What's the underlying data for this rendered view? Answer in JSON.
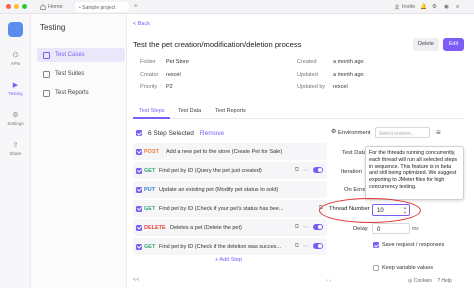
{
  "topbar": {
    "home_label": "Home",
    "tab_label": "Sample project",
    "invite_label": "Invite",
    "window_dots": [
      "#ff5f57",
      "#febc2e",
      "#28c840"
    ]
  },
  "rail": {
    "items": [
      {
        "label": "APIs",
        "icon": "api-icon"
      },
      {
        "label": "Testing",
        "icon": "testing-icon"
      },
      {
        "label": "Settings",
        "icon": "settings-icon"
      },
      {
        "label": "Share",
        "icon": "share-icon"
      }
    ]
  },
  "sidebar": {
    "project_title": "Testing",
    "items": [
      {
        "label": "Test Cases",
        "icon": "test-cases-icon"
      },
      {
        "label": "Test Suites",
        "icon": "test-suites-icon"
      },
      {
        "label": "Test Reports",
        "icon": "test-reports-icon"
      }
    ]
  },
  "header": {
    "back_label": "Back",
    "title": "Test the pet creation/modification/deletion process",
    "delete_label": "Delete",
    "edit_label": "Edit",
    "accent_color": "#7b5cf5"
  },
  "meta": {
    "folder_label": "Folder",
    "folder_value": "Pet Store",
    "creator_label": "Creator",
    "creator_value": "rexcel",
    "priority_label": "Priority",
    "priority_value": "P2",
    "created_label": "Created",
    "created_value": "a month ago",
    "updated_label": "Updated",
    "updated_value": "a month ago",
    "updated_by_label": "Updated by",
    "updated_by_value": "rexcel"
  },
  "tabs": [
    "Test Steps",
    "Test Data",
    "Test Reports"
  ],
  "steps": {
    "selected_label": "6 Step Selected",
    "remove_label": "Remove",
    "add_step_label": "+ Add Step",
    "items": [
      {
        "method": "POST",
        "desc": "Add a new pet to the store (Create Pet for Sale)"
      },
      {
        "method": "GET",
        "desc": "Find pet by ID (Query the pet just created)"
      },
      {
        "method": "PUT",
        "desc": "Update an existing pet (Modify pet status to sold)"
      },
      {
        "method": "GET",
        "desc": "Find pet by ID (Check if your pet's status has bee..."
      },
      {
        "method": "DELETE",
        "desc": "Deletes a pet (Delete the pet)"
      },
      {
        "method": "GET",
        "desc": "Find pet by ID (Check if the deletion was succes..."
      }
    ]
  },
  "settings": {
    "environment_label": "Environment",
    "environment_placeholder": "Select environ...",
    "test_data_label": "Test Data",
    "iterations_label": "Iteration",
    "on_error_label": "On Error",
    "tooltip_text": "For the threads running concurrently, each thread will run all selected steps in sequence. This feature is in beta and still being optimized. We suggest exporting to JMeter files for high concurrency testing.",
    "thread_number_label": "Thread Number",
    "thread_number_value": "10",
    "delay_label": "Delay",
    "delay_value": "0",
    "delay_unit": "ms",
    "save_request_label": "Save request / responses",
    "keep_variable_label": "Keep variable values",
    "cookies_label": "Cookies",
    "help_label": "Help",
    "collapse_label": "<<"
  }
}
